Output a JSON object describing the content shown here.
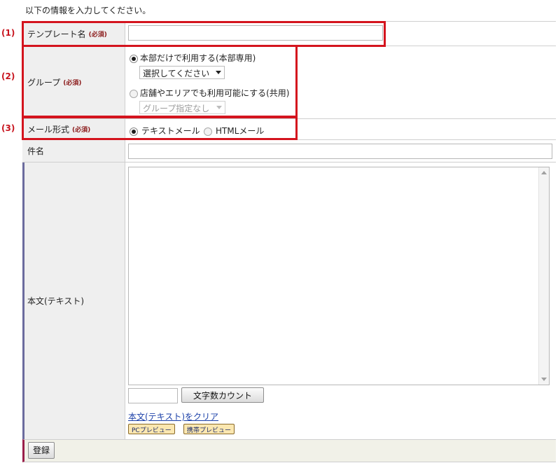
{
  "intro": "以下の情報を入力してください。",
  "markers": [
    "(1)",
    "(2)",
    "(3)"
  ],
  "required_tag": "(必須)",
  "fields": {
    "template_name": {
      "label": "テンプレート名",
      "value": ""
    },
    "group": {
      "label": "グループ",
      "option_hq": "本部だけで利用する(本部専用)",
      "option_hq_select": "選択してください",
      "option_shared": "店舗やエリアでも利用可能にする(共用)",
      "option_shared_select": "グループ指定なし",
      "selected": "hq"
    },
    "mail_format": {
      "label": "メール形式",
      "option_text": "テキストメール",
      "option_html": "HTMLメール",
      "selected": "text"
    },
    "subject": {
      "label": "件名",
      "value": ""
    },
    "body": {
      "label": "本文(テキスト)",
      "value": "",
      "count_value": "",
      "count_button": "文字数カウント",
      "clear_link": "本文(テキスト)をクリア",
      "pc_preview": "PCプレビュー",
      "mobile_preview": "携帯プレビュー"
    }
  },
  "submit": "登録",
  "colors": {
    "highlight": "#d4141e",
    "marker": "#c8141e",
    "link": "#1a3fa8"
  }
}
